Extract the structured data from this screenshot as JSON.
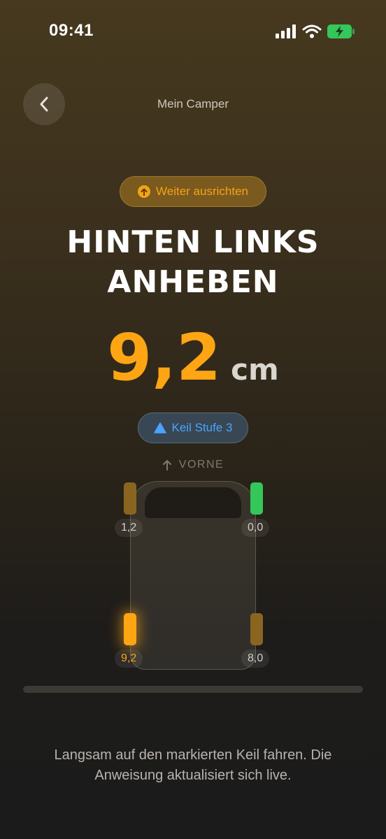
{
  "status_bar": {
    "time": "09:41"
  },
  "header": {
    "title": "Mein Camper"
  },
  "instruction_pill": {
    "label": "Weiter ausrichten"
  },
  "headline": {
    "line1": "HINTEN LINKS",
    "line2": "ANHEBEN"
  },
  "measurement": {
    "value": "9,2",
    "unit": "cm"
  },
  "wedge": {
    "label": "Keil Stufe 3"
  },
  "orientation": {
    "label": "VORNE"
  },
  "wheels": {
    "front_left": {
      "value": "1,2"
    },
    "front_right": {
      "value": "0,0"
    },
    "rear_left": {
      "value": "9,2"
    },
    "rear_right": {
      "value": "8,0"
    }
  },
  "progress": {
    "fraction": 0
  },
  "hint": {
    "text": "Langsam auf den markierten Keil fahren. Die Anweisung aktualisiert sich live."
  },
  "colors": {
    "accent": "#fea514",
    "ok": "#34c759",
    "info": "#4aa3ff",
    "warn_dim": "#8a6520"
  }
}
